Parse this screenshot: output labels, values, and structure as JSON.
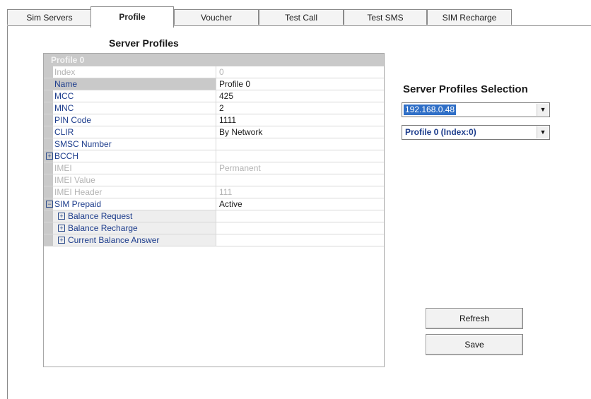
{
  "tabs": [
    "Sim Servers",
    "Profile",
    "Voucher",
    "Test Call",
    "Test SMS",
    "SIM Recharge"
  ],
  "section_title": "Server Profiles",
  "grid": {
    "header": "Profile 0",
    "rows": [
      {
        "label": "Index",
        "value": "0"
      },
      {
        "label": "Name",
        "value": "Profile 0"
      },
      {
        "label": "MCC",
        "value": "425"
      },
      {
        "label": "MNC",
        "value": "2"
      },
      {
        "label": "PIN Code",
        "value": "1111"
      },
      {
        "label": "CLIR",
        "value": "By Network"
      },
      {
        "label": "SMSC Number",
        "value": ""
      },
      {
        "label": "BCCH",
        "value": ""
      },
      {
        "label": "IMEI",
        "value": "Permanent"
      },
      {
        "label": "IMEI Value",
        "value": ""
      },
      {
        "label": "IMEI Header",
        "value": "111"
      },
      {
        "label": "SIM Prepaid",
        "value": "Active"
      },
      {
        "label": "Balance Request",
        "value": ""
      },
      {
        "label": "Balance Recharge",
        "value": ""
      },
      {
        "label": "Current Balance Answer",
        "value": ""
      }
    ],
    "expand_glyph": "+",
    "collapse_glyph": "−"
  },
  "selection": {
    "title": "Server Profiles Selection",
    "server_value": "192.168.0.48",
    "profile_value": "Profile 0 (Index:0)",
    "dropdown_glyph": "▼"
  },
  "buttons": {
    "refresh": "Refresh",
    "save": "Save"
  },
  "colors": {
    "accent": "#2f6fc7",
    "label_blue": "#1c3c8c",
    "disabled": "#b3b3b3"
  }
}
